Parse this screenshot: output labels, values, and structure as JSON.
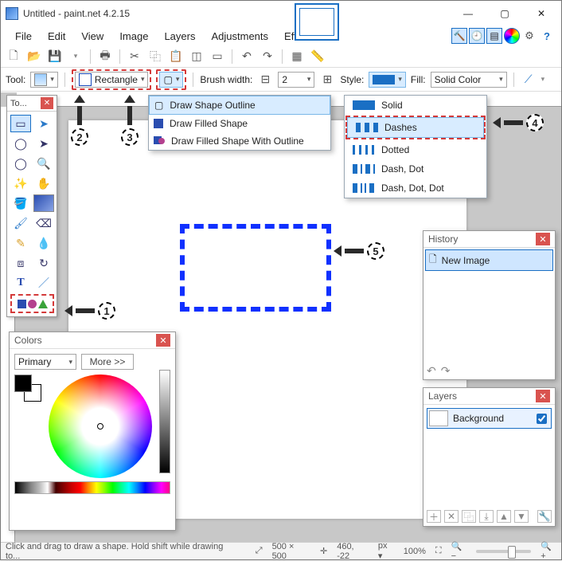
{
  "title": "Untitled - paint.net 4.2.15",
  "winbuttons": {
    "min": "—",
    "max": "▢",
    "close": "✕"
  },
  "menus": [
    "File",
    "Edit",
    "View",
    "Image",
    "Layers",
    "Adjustments",
    "Effects"
  ],
  "toolbar_icons": [
    "new",
    "open",
    "save",
    "sep",
    "print",
    "sep",
    "cut",
    "copy",
    "paste",
    "crop",
    "deselect",
    "sep",
    "undo",
    "redo",
    "sep",
    "grid",
    "ruler"
  ],
  "optbar": {
    "tool_label": "Tool:",
    "shape_label": "Rectangle",
    "brush_label": "Brush width:",
    "brush_value": "2",
    "style_label": "Style:",
    "fill_label": "Fill:",
    "fill_value": "Solid Color"
  },
  "fill_menu": [
    {
      "label": "Draw Shape Outline",
      "sel": true
    },
    {
      "label": "Draw Filled Shape",
      "sel": false
    },
    {
      "label": "Draw Filled Shape With Outline",
      "sel": false
    }
  ],
  "style_menu": [
    {
      "label": "Solid",
      "cls": "style-swatch"
    },
    {
      "label": "Dashes",
      "cls": "style-swatch dashes",
      "sel": true
    },
    {
      "label": "Dotted",
      "cls": "style-swatch dotted"
    },
    {
      "label": "Dash, Dot",
      "cls": "style-swatch dashdot"
    },
    {
      "label": "Dash, Dot, Dot",
      "cls": "style-swatch dashdotdot"
    }
  ],
  "tools_panel": {
    "title": "To..."
  },
  "colors_panel": {
    "title": "Colors",
    "primary_label": "Primary",
    "more_label": "More >>"
  },
  "history_panel": {
    "title": "History",
    "item": "New Image"
  },
  "layers_panel": {
    "title": "Layers",
    "item": "Background"
  },
  "status": {
    "hint": "Click and drag to draw a shape. Hold shift while drawing to...",
    "dims": "500 × 500",
    "cursor": "460, -22",
    "unit": "px",
    "zoom": "100%"
  },
  "annotations": {
    "1": "1",
    "2": "2",
    "3": "3",
    "4": "4",
    "5": "5"
  }
}
